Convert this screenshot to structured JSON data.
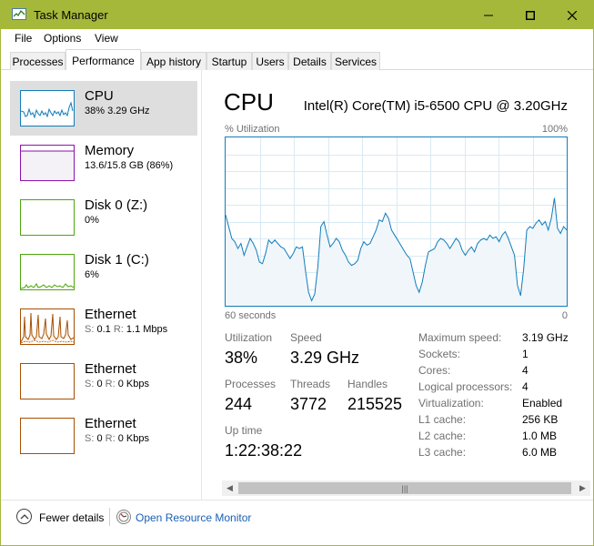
{
  "window": {
    "title": "Task Manager",
    "icon": "task-manager-icon",
    "controls": {
      "minimize": "─",
      "maximize": "☐",
      "close": "✕"
    }
  },
  "menu": [
    "File",
    "Options",
    "View"
  ],
  "tabs": [
    {
      "label": "Processes",
      "active": false
    },
    {
      "label": "Performance",
      "active": true
    },
    {
      "label": "App history",
      "active": false
    },
    {
      "label": "Startup",
      "active": false
    },
    {
      "label": "Users",
      "active": false
    },
    {
      "label": "Details",
      "active": false
    },
    {
      "label": "Services",
      "active": false
    }
  ],
  "resources": [
    {
      "name": "CPU",
      "detail_value": "38%  3.29 GHz",
      "color": "#117dbb",
      "selected": true
    },
    {
      "name": "Memory",
      "detail_value": "13.6/15.8 GB (86%)",
      "color": "#8b12ae",
      "selected": false
    },
    {
      "name": "Disk 0 (Z:)",
      "detail_value": "0%",
      "color": "#4da60c",
      "selected": false
    },
    {
      "name": "Disk 1 (C:)",
      "detail_value": "6%",
      "color": "#4da60c",
      "selected": false
    },
    {
      "name": "Ethernet",
      "send_label": "S:",
      "send_value": "0.1",
      "recv_label": "R:",
      "recv_value": "1.1 Mbps",
      "color": "#a74f01",
      "selected": false
    },
    {
      "name": "Ethernet",
      "send_label": "S:",
      "send_value": "0",
      "recv_label": "R:",
      "recv_value": "0 Kbps",
      "color": "#a74f01",
      "selected": false
    },
    {
      "name": "Ethernet",
      "send_label": "S:",
      "send_value": "0",
      "recv_label": "R:",
      "recv_value": "0 Kbps",
      "color": "#a74f01",
      "selected": false
    }
  ],
  "cpu": {
    "title": "CPU",
    "model": "Intel(R) Core(TM) i5-6500 CPU @ 3.20GHz",
    "graph_label": "% Utilization",
    "graph_max": "100%",
    "axis_left": "60 seconds",
    "axis_right": "0",
    "graph_values": [
      54,
      47,
      40,
      38,
      34,
      37,
      30,
      35,
      40,
      37,
      33,
      26,
      25,
      31,
      39,
      37,
      39,
      37,
      35,
      34,
      31,
      28,
      31,
      35,
      34,
      35,
      21,
      8,
      3,
      7,
      23,
      47,
      50,
      42,
      35,
      37,
      40,
      38,
      33,
      30,
      26,
      24,
      25,
      27,
      34,
      38,
      36,
      37,
      41,
      45,
      51,
      50,
      55,
      52,
      45,
      42,
      39,
      36,
      33,
      30,
      28,
      20,
      12,
      8,
      14,
      24,
      32,
      33,
      34,
      38,
      40,
      39,
      37,
      34,
      37,
      40,
      38,
      33,
      30,
      33,
      35,
      32,
      37,
      39,
      40,
      39,
      42,
      40,
      41,
      38,
      42,
      44,
      40,
      35,
      30,
      12,
      6,
      22,
      45,
      47,
      46,
      49,
      51,
      48,
      50,
      45,
      52,
      64,
      46,
      43,
      47,
      45
    ],
    "utilization_label": "Utilization",
    "utilization_value": "38%",
    "speed_label": "Speed",
    "speed_value": "3.29 GHz",
    "processes_label": "Processes",
    "processes_value": "244",
    "threads_label": "Threads",
    "threads_value": "3772",
    "handles_label": "Handles",
    "handles_value": "215525",
    "uptime_label": "Up time",
    "uptime_value": "1:22:38:22",
    "specs": [
      {
        "label": "Maximum speed:",
        "value": "3.19 GHz"
      },
      {
        "label": "Sockets:",
        "value": "1"
      },
      {
        "label": "Cores:",
        "value": "4"
      },
      {
        "label": "Logical processors:",
        "value": "4"
      },
      {
        "label": "Virtualization:",
        "value": "Enabled"
      },
      {
        "label": "L1 cache:",
        "value": "256 KB"
      },
      {
        "label": "L2 cache:",
        "value": "1.0 MB"
      },
      {
        "label": "L3 cache:",
        "value": "6.0 MB"
      }
    ]
  },
  "footer": {
    "fewer_details": "Fewer details",
    "open_resource_monitor": "Open Resource Monitor"
  },
  "colors": {
    "accent": "#a6b83a",
    "cpu": "#117dbb",
    "cpu_fill": "#f1f6fa",
    "link": "#1a5fb4"
  }
}
